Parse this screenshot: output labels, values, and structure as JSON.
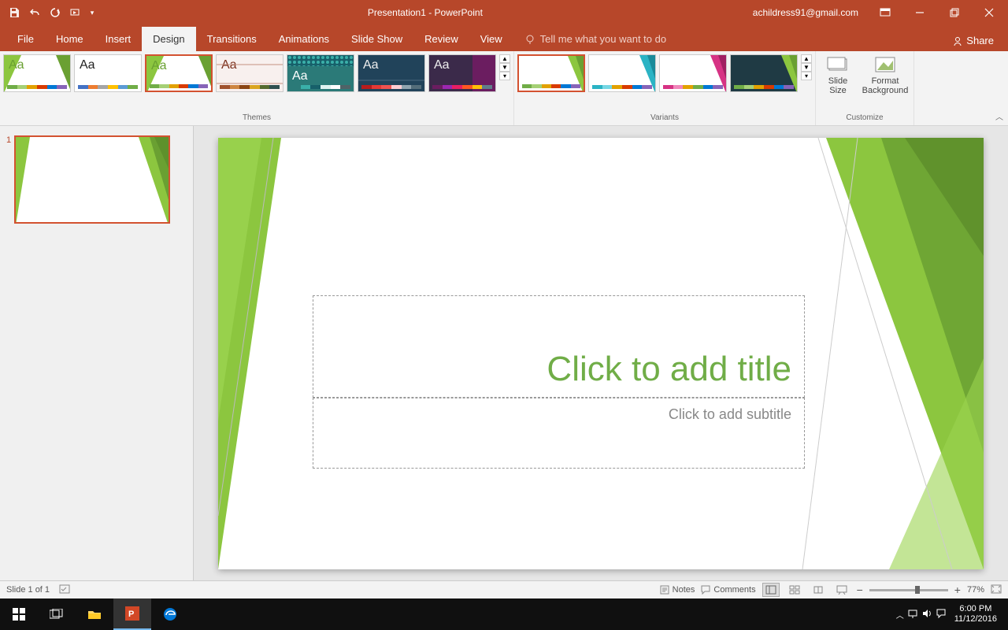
{
  "app": {
    "title": "Presentation1  -  PowerPoint",
    "user": "achildress91@gmail.com"
  },
  "tabs": {
    "file": "File",
    "home": "Home",
    "insert": "Insert",
    "design": "Design",
    "transitions": "Transitions",
    "animations": "Animations",
    "slideshow": "Slide Show",
    "review": "Review",
    "view": "View",
    "tellme": "Tell me what you want to do",
    "share": "Share"
  },
  "ribbon": {
    "themes_label": "Themes",
    "variants_label": "Variants",
    "customize_label": "Customize",
    "slide_size": "Slide Size",
    "format_bg": "Format Background"
  },
  "slide": {
    "number": "1",
    "title_placeholder": "Click to add title",
    "subtitle_placeholder": "Click to add subtitle"
  },
  "status": {
    "slide_count": "Slide 1 of 1",
    "notes": "Notes",
    "comments": "Comments",
    "zoom": "77%"
  },
  "taskbar": {
    "time": "6:00 PM",
    "date": "11/12/2016"
  }
}
